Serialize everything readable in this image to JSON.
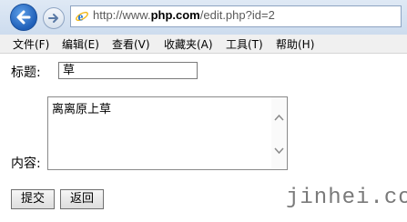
{
  "browser": {
    "url_prefix": "http://www.",
    "url_domain": "php.com",
    "url_path": "/edit.php?id=2",
    "back_icon": "back-arrow-icon",
    "forward_icon": "forward-arrow-icon",
    "page_icon": "ie-icon"
  },
  "menu": {
    "items": [
      {
        "label": "文件(F)"
      },
      {
        "label": "编辑(E)"
      },
      {
        "label": "查看(V)"
      },
      {
        "label": "收藏夹(A)"
      },
      {
        "label": "工具(T)"
      },
      {
        "label": "帮助(H)"
      }
    ]
  },
  "form": {
    "title_label": "标题:",
    "title_value": "草",
    "content_label": "内容:",
    "content_value": "离离原上草",
    "submit_label": "提交",
    "back_label": "返回"
  },
  "watermark": "jinhei.com",
  "colors": {
    "titlebar": "#dfe9f5",
    "back_button": "#1f5fb8",
    "menubar": "#f0f0f0"
  }
}
